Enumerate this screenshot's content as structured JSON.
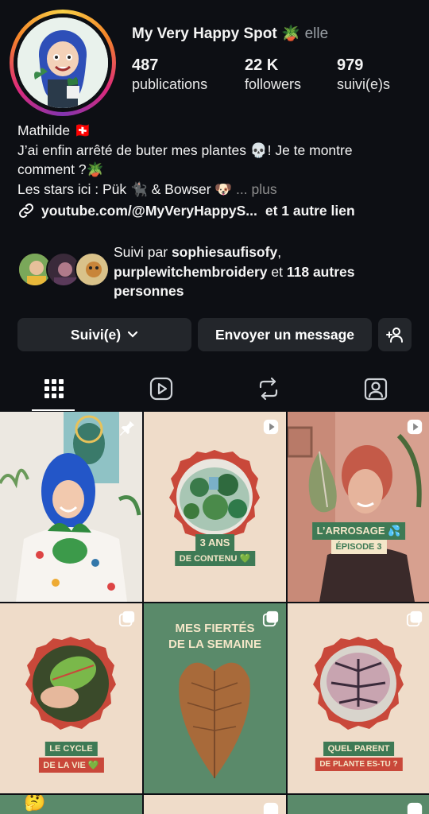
{
  "profile": {
    "name": "My Very Happy Spot 🪴",
    "pronoun": "elle"
  },
  "stats": [
    {
      "value": "487",
      "label": "publications"
    },
    {
      "value": "22 K",
      "label": "followers"
    },
    {
      "value": "979",
      "label": "suivi(e)s"
    }
  ],
  "bio": {
    "line1": "Mathilde 🇨🇭",
    "line2": "J’ai enfin arrêté de buter mes plantes 💀! Je te montre",
    "line3": "comment ?🪴",
    "line4": "Les stars ici : Pük 🐈‍⬛ & Bowser 🐶 ",
    "more": "... plus",
    "link": "youtube.com/@MyVeryHappyS...",
    "other_links": "et 1 autre lien"
  },
  "followed_by": {
    "prefix": "Suivi par ",
    "user1": "sophiesaufisofy",
    "sep": ",",
    "user2": "purplewitchembroidery",
    "mid": " et ",
    "others": "118 autres personnes"
  },
  "buttons": {
    "following": "Suivi(e)",
    "message": "Envoyer un message"
  },
  "tabs": [
    "grid-icon",
    "reels-icon",
    "reposts-icon",
    "tagged-icon"
  ],
  "posts": [
    {
      "type": "photo",
      "pinned": true
    },
    {
      "type": "reel",
      "caption1": "3 ANS",
      "caption2": "DE CONTENU 💚"
    },
    {
      "type": "reel",
      "caption1": "L’ARROSAGE 💦",
      "caption2": "ÉPISODE 3"
    },
    {
      "type": "carousel",
      "caption1": "LE CYCLE",
      "caption2": "DE LA VIE 💚"
    },
    {
      "type": "carousel",
      "title1": "MES FIERTÉS",
      "title2": "DE LA SEMAINE"
    },
    {
      "type": "carousel",
      "caption1": "QUEL PARENT",
      "caption2": "DE PLANTE ES-TU ?"
    }
  ],
  "colors": {
    "background": "#0d0f14",
    "button": "#23262b",
    "beige": "#efdcc9",
    "red_frame": "#c9483a",
    "green_label": "#3e7a55",
    "sage": "#5a8a6a"
  }
}
